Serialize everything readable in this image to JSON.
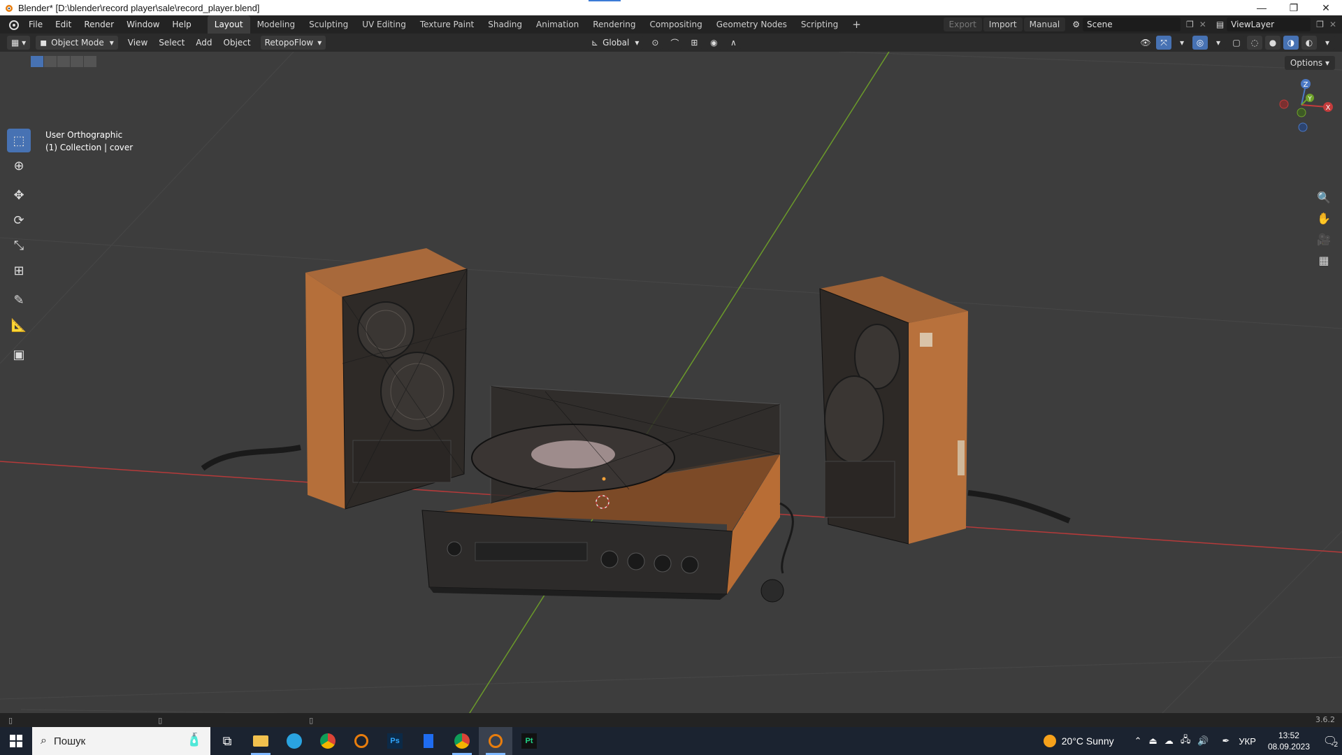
{
  "window": {
    "title": "Blender* [D:\\blender\\record player\\sale\\record_player.blend]",
    "minimize": "—",
    "maximize": "❐",
    "close": "✕"
  },
  "menubar": {
    "items": [
      "File",
      "Edit",
      "Render",
      "Window",
      "Help"
    ],
    "workspaces": [
      "Layout",
      "Modeling",
      "Sculpting",
      "UV Editing",
      "Texture Paint",
      "Shading",
      "Animation",
      "Rendering",
      "Compositing",
      "Geometry Nodes",
      "Scripting"
    ],
    "active_workspace": "Layout",
    "add_tab": "+",
    "export_label": "Export",
    "import_label": "Import",
    "manual_label": "Manual",
    "scene_label": "Scene",
    "viewlayer_label": "ViewLayer"
  },
  "viewport_header": {
    "mode": "Object Mode",
    "menus": [
      "View",
      "Select",
      "Add",
      "Object"
    ],
    "addon_menu": "RetopoFlow",
    "orientation": "Global",
    "options_label": "Options"
  },
  "viewport": {
    "view_name": "User Orthographic",
    "collection_info": "(1) Collection | cover",
    "gizmo": {
      "x": "X",
      "y": "Y",
      "z": "Z"
    },
    "colors": {
      "x_axis": "#c43c3c",
      "y_axis": "#6fa32a",
      "z_axis": "#4b78c4",
      "bg": "#3d3d3d"
    }
  },
  "statusbar": {
    "version": "3.6.2"
  },
  "taskbar": {
    "search_placeholder": "Пошук",
    "weather": "20°C  Sunny",
    "lang": "УКР",
    "time": "13:52",
    "date": "08.09.2023",
    "notif_count": "2",
    "apps": [
      "task-view",
      "file-explorer",
      "telegram",
      "chrome",
      "blender",
      "photoshop",
      "bookmark-app",
      "chrome",
      "blender-active",
      "pycharm"
    ]
  }
}
